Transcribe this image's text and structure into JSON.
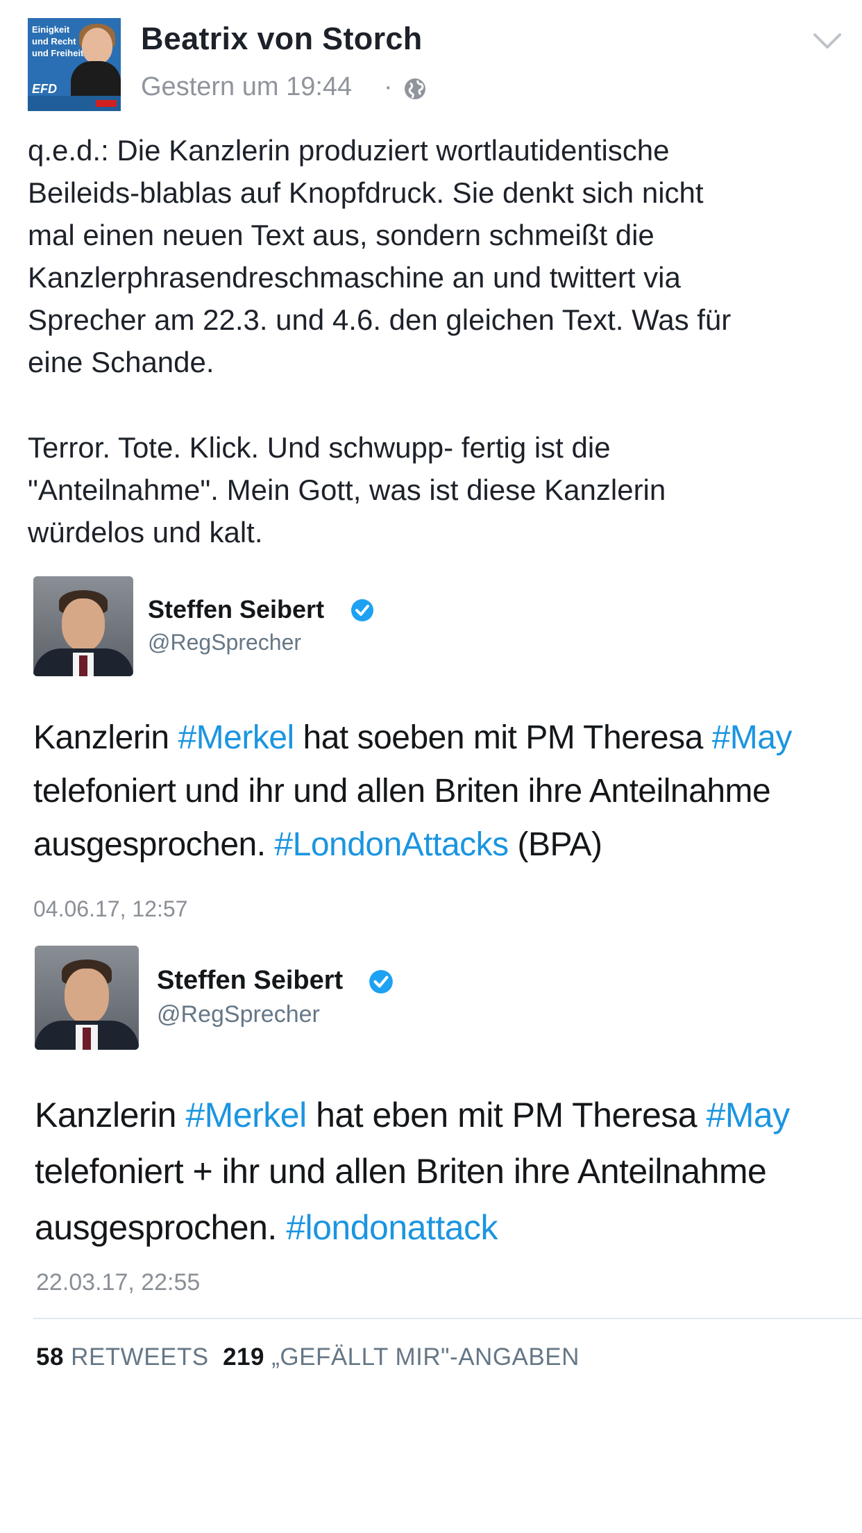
{
  "post": {
    "author": "Beatrix von Storch",
    "avatar_text": "Einigkeit\nund Recht\nund Freiheit!",
    "avatar_badge": "EFD",
    "timestamp": "Gestern um 19:44",
    "separator": "·",
    "privacy_icon": "globe-icon",
    "menu_icon": "chevron-down-icon",
    "paragraph1_lines": [
      "q.e.d.: Die Kanzlerin produziert wortlautidentische",
      "Beileids-blablas auf Knopfdruck. Sie denkt sich nicht",
      "mal einen neuen Text aus, sondern schmeißt die",
      "Kanzlerphrasendreschmaschine  an und twittert via",
      "Sprecher am 22.3. und 4.6. den gleichen Text. Was für",
      "eine Schande."
    ],
    "paragraph2_lines": [
      "Terror. Tote. Klick. Und schwupp- fertig ist die",
      "\"Anteilnahme\". Mein Gott, was ist diese Kanzlerin",
      "würdelos und kalt."
    ]
  },
  "tweets": [
    {
      "name": "Steffen Seibert",
      "handle": "@RegSprecher",
      "line1": {
        "a": "Kanzlerin ",
        "tag1": "#Merkel",
        "b": " hat soeben mit PM Theresa ",
        "tag2": "#May"
      },
      "line2": "telefoniert und ihr und allen Briten ihre Anteilnahme",
      "line3": {
        "a": "ausgesprochen. ",
        "tag": "#LondonAttacks",
        "b": " (BPA)"
      },
      "date": "04.06.17, 12:57"
    },
    {
      "name": "Steffen Seibert",
      "handle": "@RegSprecher",
      "line1": {
        "a": "Kanzlerin ",
        "tag1": "#Merkel",
        "b": " hat eben mit PM Theresa ",
        "tag2": "#May"
      },
      "line2": "telefoniert + ihr und allen Briten ihre Anteilnahme",
      "line3": {
        "a": "ausgesprochen. ",
        "tag": "#londonattack",
        "b": ""
      },
      "date": "22.03.17, 22:55"
    }
  ],
  "stats": {
    "retweets_count": "58",
    "retweets_label": "RETWEETS",
    "likes_count": "219",
    "likes_label": "„GEFÄLLT MIR\"-ANGABEN"
  },
  "colors": {
    "hashtag": "#1b95e0",
    "verified": "#1da1f2",
    "meta": "#90949c"
  }
}
